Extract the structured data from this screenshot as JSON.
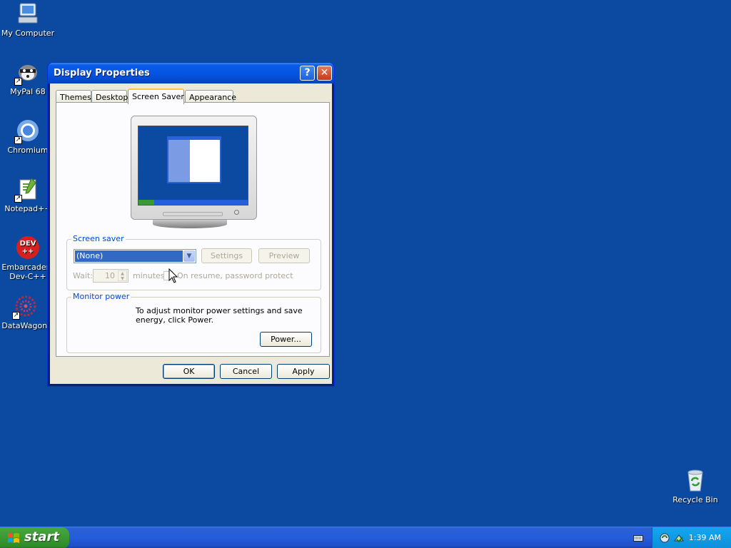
{
  "desktop": {
    "icons": [
      {
        "label": "My Computer"
      },
      {
        "label": "MyPal 68"
      },
      {
        "label": "Chromium"
      },
      {
        "label": "Notepad++"
      },
      {
        "label": "Embarcadero Dev-C++"
      },
      {
        "label": "DataWagon."
      },
      {
        "label": "Recycle Bin"
      }
    ],
    "devcpp_badge": "DEV\n++"
  },
  "window": {
    "title": "Display Properties",
    "help_button": "?",
    "close_button": "✕",
    "tabs": [
      {
        "label": "Themes"
      },
      {
        "label": "Desktop"
      },
      {
        "label": "Screen Saver"
      },
      {
        "label": "Appearance"
      }
    ],
    "active_tab": "Screen Saver",
    "screen_saver": {
      "group_title": "Screen saver",
      "selected": "(None)",
      "settings_label": "Settings",
      "preview_label": "Preview",
      "wait_label": "Wait:",
      "wait_value": "10",
      "minutes_label": "minutes",
      "resume_label": "On resume, password protect"
    },
    "monitor_power": {
      "group_title": "Monitor power",
      "description": "To adjust monitor power settings and save energy, click Power.",
      "power_label": "Power..."
    },
    "buttons": {
      "ok": "OK",
      "cancel": "Cancel",
      "apply": "Apply"
    }
  },
  "taskbar": {
    "start_label": "start",
    "clock": "1:39 AM"
  },
  "colors": {
    "desktop_bg": "#0b4aa0",
    "taskbar_blue": "#245ddb",
    "start_green": "#3d9c35",
    "selection": "#316ac5"
  }
}
